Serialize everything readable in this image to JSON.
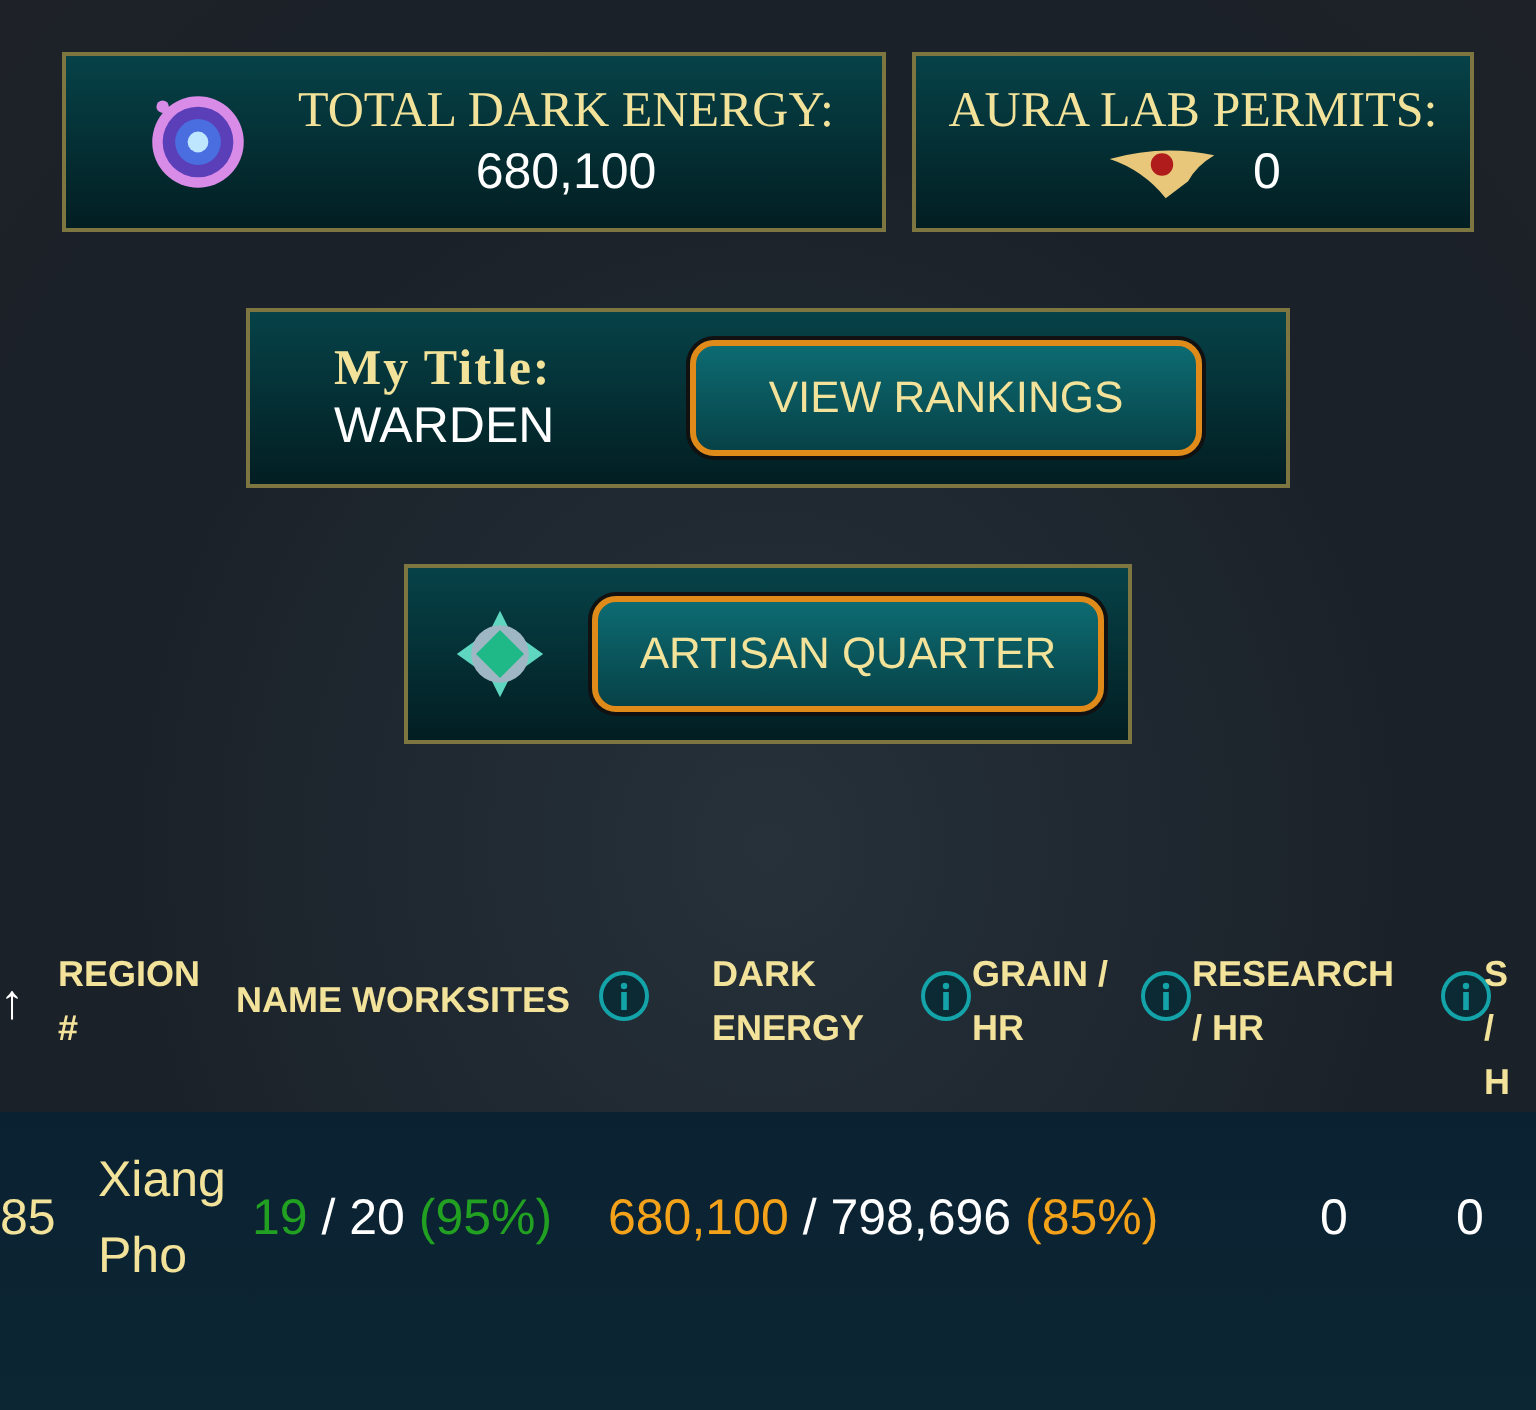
{
  "resources": [
    {
      "kind": "energy",
      "label": "TOTAL DARK ENERGY:",
      "value": "680,100"
    },
    {
      "kind": "permit",
      "label": "AURA LAB PERMITS:",
      "value": "0"
    }
  ],
  "title_panel": {
    "label": "My Title:",
    "value": "WARDEN",
    "button": "VIEW RANKINGS"
  },
  "artisan_button": "ARTISAN QUARTER",
  "table": {
    "sort_arrow": "↑",
    "columns": [
      {
        "label": "REGION #",
        "info": false
      },
      {
        "label": "NAME",
        "info": false
      },
      {
        "label": "WORKSITES",
        "info": true
      },
      {
        "label": "DARK ENERGY",
        "info": true
      },
      {
        "label": "GRAIN / HR",
        "info": true
      },
      {
        "label": "RESEARCH / HR",
        "info": true
      },
      {
        "label": "S / H",
        "info": false
      }
    ],
    "rows": [
      {
        "region": "85",
        "name": "Xiang Pho",
        "worksites": {
          "used": "19",
          "total": "/ 20",
          "percent": "(95%)"
        },
        "dark_energy": {
          "current": "680,100",
          "capacity": "/ 798,696",
          "percent": "(85%)"
        },
        "grain": "0",
        "research": "0"
      }
    ]
  }
}
